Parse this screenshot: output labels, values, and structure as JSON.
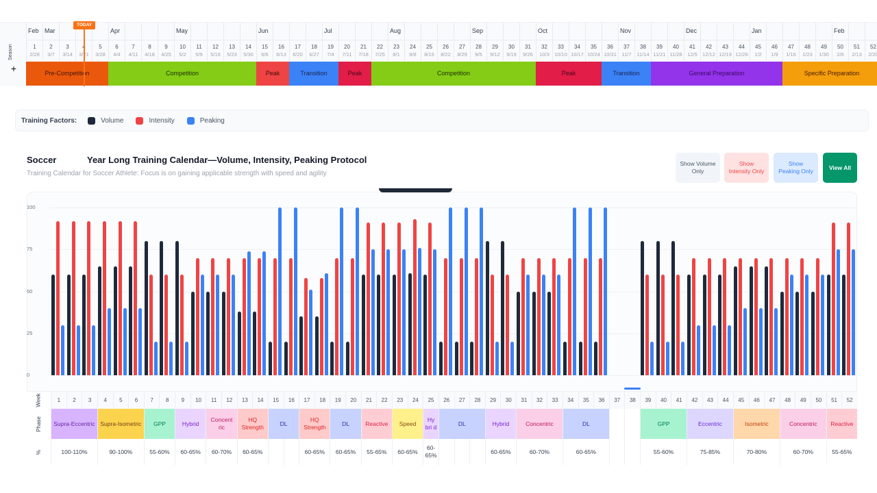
{
  "timeline": {
    "season_label": "Season",
    "add_label": "+",
    "today_label": "TODAY",
    "today_week": 4,
    "months": [
      {
        "label": "Feb",
        "week": 1
      },
      {
        "label": "Mar",
        "week": 2
      },
      {
        "label": "Apr",
        "week": 6
      },
      {
        "label": "May",
        "week": 10
      },
      {
        "label": "Jun",
        "week": 15
      },
      {
        "label": "Jul",
        "week": 19
      },
      {
        "label": "Aug",
        "week": 23
      },
      {
        "label": "Sep",
        "week": 28
      },
      {
        "label": "Oct",
        "week": 32
      },
      {
        "label": "Nov",
        "week": 37
      },
      {
        "label": "Dec",
        "week": 41
      },
      {
        "label": "Jan",
        "week": 45
      },
      {
        "label": "Feb",
        "week": 50
      }
    ],
    "week_dates": [
      "2/28",
      "3/7",
      "3/14",
      "3/21",
      "3/28",
      "4/4",
      "4/11",
      "4/18",
      "4/25",
      "5/2",
      "5/9",
      "5/16",
      "5/23",
      "5/30",
      "6/6",
      "6/13",
      "6/20",
      "6/27",
      "7/4",
      "7/11",
      "7/18",
      "7/25",
      "8/1",
      "8/8",
      "8/15",
      "8/22",
      "8/29",
      "9/5",
      "9/12",
      "9/19",
      "9/26",
      "10/3",
      "10/10",
      "10/17",
      "10/24",
      "10/31",
      "11/7",
      "11/14",
      "11/21",
      "11/28",
      "12/5",
      "12/12",
      "12/19",
      "12/26",
      "1/2",
      "1/9",
      "1/16",
      "1/23",
      "1/30",
      "2/6",
      "2/13",
      "2/20"
    ],
    "seasons": [
      {
        "label": "Pre-Competition",
        "start": 1,
        "end": 5,
        "color": "#ea580c",
        "text": "#431407"
      },
      {
        "label": "Competition",
        "start": 6,
        "end": 14,
        "color": "#84cc16",
        "text": "#1a2e05"
      },
      {
        "label": "Peak",
        "start": 15,
        "end": 16,
        "color": "#ef4444",
        "text": "#450a0a"
      },
      {
        "label": "Transition",
        "start": 17,
        "end": 19,
        "color": "#3b82f6",
        "text": "#172554"
      },
      {
        "label": "Peak",
        "start": 20,
        "end": 21,
        "color": "#e11d48",
        "text": "#4c0519"
      },
      {
        "label": "Competition",
        "start": 22,
        "end": 31,
        "color": "#84cc16",
        "text": "#1a2e05"
      },
      {
        "label": "Peak",
        "start": 32,
        "end": 35,
        "color": "#e11d48",
        "text": "#4c0519"
      },
      {
        "label": "Transition",
        "start": 36,
        "end": 38,
        "color": "#3b82f6",
        "text": "#172554"
      },
      {
        "label": "General Preparation",
        "start": 39,
        "end": 46,
        "color": "#9333ea",
        "text": "#3b0764"
      },
      {
        "label": "Specific Preparation",
        "start": 47,
        "end": 52,
        "color": "#f59e0b",
        "text": "#451a03"
      }
    ]
  },
  "factors": {
    "label": "Training Factors:",
    "items": [
      {
        "label": "Volume",
        "color": "#1e293b"
      },
      {
        "label": "Intensity",
        "color": "#ef4444"
      },
      {
        "label": "Peaking",
        "color": "#3b82f6"
      }
    ]
  },
  "header": {
    "sport": "Soccer",
    "title": "Year Long Training Calendar—Volume, Intensity, Peaking Protocol",
    "subtitle": "Training Calendar for Soccer Athlete: Focus is on gaining applicable strength with speed and agility"
  },
  "buttons": {
    "volume": "Show Volume Only",
    "intensity": "Show Intensity Only",
    "peaking": "Show Peaking Only",
    "all": "View All"
  },
  "chart_data": {
    "type": "bar",
    "ylim": [
      0,
      100
    ],
    "yticks": [
      "0",
      "25",
      "50",
      "75",
      "100"
    ],
    "categories": "weeks 1-52",
    "series": [
      {
        "name": "Volume",
        "color": "#1e293b",
        "values": [
          60,
          60,
          60,
          65,
          65,
          65,
          80,
          80,
          80,
          50,
          50,
          50,
          38,
          38,
          20,
          20,
          35,
          35,
          20,
          20,
          60,
          60,
          60,
          61,
          60,
          20,
          20,
          20,
          80,
          80,
          50,
          50,
          50,
          20,
          20,
          20,
          null,
          null,
          80,
          80,
          80,
          60,
          60,
          60,
          65,
          65,
          65,
          50,
          50,
          50,
          60,
          60
        ]
      },
      {
        "name": "Intensity",
        "color": "#ef4444",
        "values": [
          92,
          92,
          92,
          92,
          92,
          92,
          60,
          60,
          60,
          70,
          70,
          70,
          70,
          70,
          70,
          70,
          58,
          58,
          70,
          70,
          91,
          91,
          91,
          93,
          91,
          70,
          70,
          70,
          60,
          60,
          70,
          70,
          70,
          70,
          70,
          70,
          null,
          null,
          60,
          60,
          60,
          70,
          70,
          70,
          70,
          70,
          70,
          70,
          70,
          70,
          91,
          91
        ]
      },
      {
        "name": "Peaking",
        "color": "#3b82f6",
        "values": [
          30,
          30,
          30,
          40,
          40,
          40,
          20,
          20,
          20,
          60,
          60,
          60,
          74,
          74,
          100,
          100,
          51,
          61,
          100,
          100,
          75,
          75,
          75,
          76,
          75,
          100,
          100,
          100,
          20,
          20,
          60,
          60,
          60,
          100,
          100,
          100,
          null,
          null,
          20,
          20,
          20,
          30,
          30,
          30,
          40,
          40,
          40,
          60,
          60,
          60,
          75,
          75
        ]
      }
    ]
  },
  "table": {
    "week_label": "Week",
    "phase_label": "Phase",
    "pct_label": "%",
    "phases": [
      {
        "label": "Supra-Eccentric",
        "start": 1,
        "end": 3,
        "bg": "#d8b4fe",
        "fg": "#6b21a8"
      },
      {
        "label": "Supra-Isometric",
        "start": 4,
        "end": 6,
        "bg": "#fcd34d",
        "fg": "#713f12"
      },
      {
        "label": "GPP",
        "start": 7,
        "end": 8,
        "bg": "#a7f3d0",
        "fg": "#047857"
      },
      {
        "label": "Hybrid",
        "start": 9,
        "end": 10,
        "bg": "#e9d5ff",
        "fg": "#7e22ce"
      },
      {
        "label": "Concent ric",
        "start": 11,
        "end": 12,
        "bg": "#fbcfe8",
        "fg": "#be185d"
      },
      {
        "label": "HQ Strength",
        "start": 13,
        "end": 14,
        "bg": "#fecaca",
        "fg": "#dc2626"
      },
      {
        "label": "DL",
        "start": 15,
        "end": 16,
        "bg": "#c7d2fe",
        "fg": "#3730a3"
      },
      {
        "label": "HQ Strength",
        "start": 17,
        "end": 18,
        "bg": "#fecaca",
        "fg": "#dc2626"
      },
      {
        "label": "DL",
        "start": 19,
        "end": 20,
        "bg": "#c7d2fe",
        "fg": "#3730a3"
      },
      {
        "label": "Reactive",
        "start": 21,
        "end": 22,
        "bg": "#fecdd3",
        "fg": "#e11d48"
      },
      {
        "label": "Speed",
        "start": 23,
        "end": 24,
        "bg": "#fef08a",
        "fg": "#854d0e"
      },
      {
        "label": "Hy bri d",
        "start": 25,
        "end": 25,
        "bg": "#e9d5ff",
        "fg": "#7e22ce"
      },
      {
        "label": "DL",
        "start": 26,
        "end": 28,
        "bg": "#c7d2fe",
        "fg": "#3730a3"
      },
      {
        "label": "Hybrid",
        "start": 29,
        "end": 30,
        "bg": "#e9d5ff",
        "fg": "#7e22ce"
      },
      {
        "label": "Concentric",
        "start": 31,
        "end": 33,
        "bg": "#fbcfe8",
        "fg": "#be185d"
      },
      {
        "label": "DL",
        "start": 34,
        "end": 36,
        "bg": "#c7d2fe",
        "fg": "#3730a3"
      },
      {
        "label": "GPP",
        "start": 39,
        "end": 41,
        "bg": "#a7f3d0",
        "fg": "#047857"
      },
      {
        "label": "Eccentric",
        "start": 42,
        "end": 44,
        "bg": "#ddd6fe",
        "fg": "#6d28d9"
      },
      {
        "label": "Isometric",
        "start": 45,
        "end": 47,
        "bg": "#fed7aa",
        "fg": "#c2410c"
      },
      {
        "label": "Concentric",
        "start": 48,
        "end": 50,
        "bg": "#fbcfe8",
        "fg": "#be185d"
      },
      {
        "label": "Reactive",
        "start": 51,
        "end": 52,
        "bg": "#fecdd3",
        "fg": "#e11d48"
      }
    ],
    "percents": [
      {
        "label": "100-110%",
        "start": 1,
        "end": 3
      },
      {
        "label": "90-100%",
        "start": 4,
        "end": 6
      },
      {
        "label": "55-60%",
        "start": 7,
        "end": 8
      },
      {
        "label": "60-65%",
        "start": 9,
        "end": 10
      },
      {
        "label": "60-70%",
        "start": 11,
        "end": 12
      },
      {
        "label": "60-65%",
        "start": 13,
        "end": 14
      },
      {
        "label": "60-65%",
        "start": 17,
        "end": 18
      },
      {
        "label": "60-65%",
        "start": 19,
        "end": 20
      },
      {
        "label": "55-65%",
        "start": 21,
        "end": 22
      },
      {
        "label": "60-65%",
        "start": 23,
        "end": 24
      },
      {
        "label": "60-65%",
        "start": 25,
        "end": 25
      },
      {
        "label": "60-65%",
        "start": 29,
        "end": 30
      },
      {
        "label": "60-70%",
        "start": 31,
        "end": 33
      },
      {
        "label": "60-65%",
        "start": 34,
        "end": 36
      },
      {
        "label": "55-60%",
        "start": 39,
        "end": 41
      },
      {
        "label": "75-85%",
        "start": 42,
        "end": 44
      },
      {
        "label": "70-80%",
        "start": 45,
        "end": 47
      },
      {
        "label": "60-70%",
        "start": 48,
        "end": 50
      },
      {
        "label": "55-65%",
        "start": 51,
        "end": 52
      }
    ]
  }
}
